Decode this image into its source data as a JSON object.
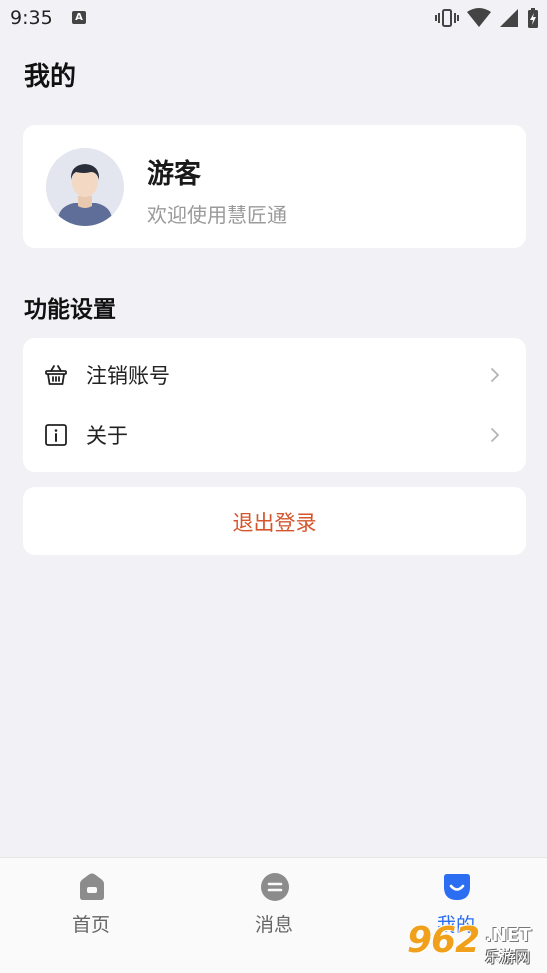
{
  "status_bar": {
    "time": "9:35",
    "a_badge": "A"
  },
  "page": {
    "title": "我的"
  },
  "profile": {
    "name": "游客",
    "subtitle": "欢迎使用慧匠通"
  },
  "settings": {
    "section_title": "功能设置",
    "items": [
      {
        "label": "注销账号",
        "icon": "basket-icon"
      },
      {
        "label": "关于",
        "icon": "info-icon"
      }
    ]
  },
  "logout": {
    "label": "退出登录"
  },
  "tabbar": {
    "tabs": [
      {
        "label": "首页",
        "icon": "home-icon",
        "active": false
      },
      {
        "label": "消息",
        "icon": "message-icon",
        "active": false
      },
      {
        "label": "我的",
        "icon": "mine-icon",
        "active": true
      }
    ]
  },
  "watermark": {
    "brand": "962",
    "net": ".NET",
    "sub": "乐游网"
  },
  "colors": {
    "background": "#f2f2f6",
    "accent": "#2b6ef2",
    "logout": "#d4562c",
    "muted": "#9a9a9a"
  }
}
